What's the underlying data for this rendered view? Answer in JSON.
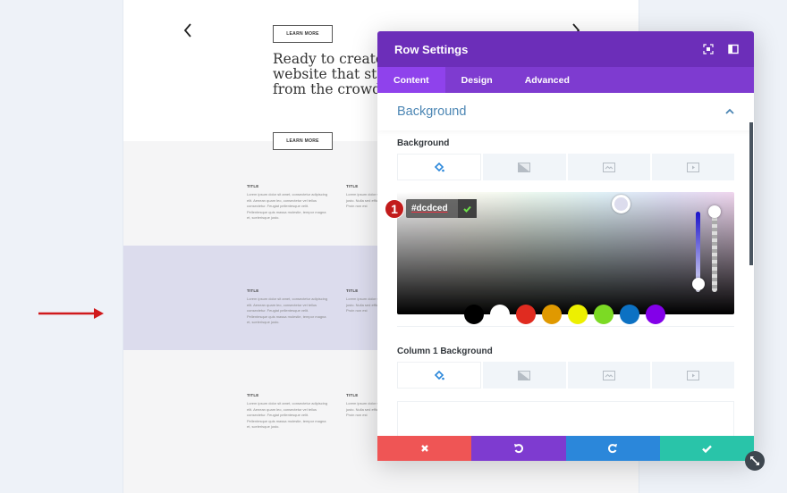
{
  "preview": {
    "learn_more_top": "LEARN MORE",
    "learn_more_bottom": "LEARN MORE",
    "hero_heading": "Ready to create a\nwebsite that stands\nfrom the crowd?",
    "sections": [
      {
        "background": "#f5f5f6",
        "blurbs": [
          {
            "title": "TITLE",
            "text": "Lorem ipsum dolor sit amet, consectetur adipiscing elit. Aenean quam leo, consectetur vel tellus consectetur. Feugiat pellentesque velit. Pellentesque quis massa molestie, tempor magna et, scelerisque justo."
          },
          {
            "title": "TITLE",
            "text": "Lorem ipsum dolor sit amet, consectetur. Feugiat justo. Nulla sed efficitur a sapien id neque in lectus. Proin non est"
          }
        ]
      },
      {
        "background": "#dcdced",
        "blurbs": [
          {
            "title": "TITLE",
            "text": "Lorem ipsum dolor sit amet, consectetur adipiscing elit. Aenean quam leo, consectetur vel tellus consectetur. Feugiat pellentesque velit. Pellentesque quis massa molestie, tempor magna et, scelerisque justo."
          },
          {
            "title": "TITLE",
            "text": "Lorem ipsum dolor sit amet, consectetur. Feugiat justo. Nulla sed efficitur a sapien id neque in lectus. Proin non est"
          }
        ]
      },
      {
        "background": "#f5f5f6",
        "blurbs": [
          {
            "title": "TITLE",
            "text": "Lorem ipsum dolor sit amet, consectetur adipiscing elit. Aenean quam leo, consectetur vel tellus consectetur. Feugiat pellentesque velit. Pellentesque quis massa molestie, tempor magna et, scelerisque justo."
          },
          {
            "title": "TITLE",
            "text": "Lorem ipsum dolor sit amet, consectetur. Feugiat justo. Nulla sed efficitur a sapien id neque in lectus. Proin non est"
          }
        ]
      }
    ]
  },
  "modal": {
    "title": "Row Settings",
    "tabs": [
      {
        "label": "Content",
        "active": true
      },
      {
        "label": "Design",
        "active": false
      },
      {
        "label": "Advanced",
        "active": false
      }
    ],
    "toggle_title": "Background",
    "background_label": "Background",
    "bg_tabs": [
      "color-icon",
      "gradient-icon",
      "image-icon",
      "video-icon"
    ],
    "color_picker": {
      "hex_value": "#dcdced",
      "step_badge": "1",
      "swatches": [
        "#000000",
        "#ffffff",
        "#e02b20",
        "#e09900",
        "#edf000",
        "#7cda24",
        "#0c71c3",
        "#8300e9"
      ]
    },
    "column1_label": "Column 1 Background",
    "footer_colors": {
      "cancel": "#ef5555",
      "undo": "#7e3bd0",
      "redo": "#2b87da",
      "save": "#29c4a9"
    }
  },
  "colors": {
    "header": "#6c2eb9",
    "tabs": "#7e3bd0",
    "active_tab": "#8f42ec",
    "accent_title": "#4c86b4",
    "annotation_arrow": "#d0191c"
  }
}
